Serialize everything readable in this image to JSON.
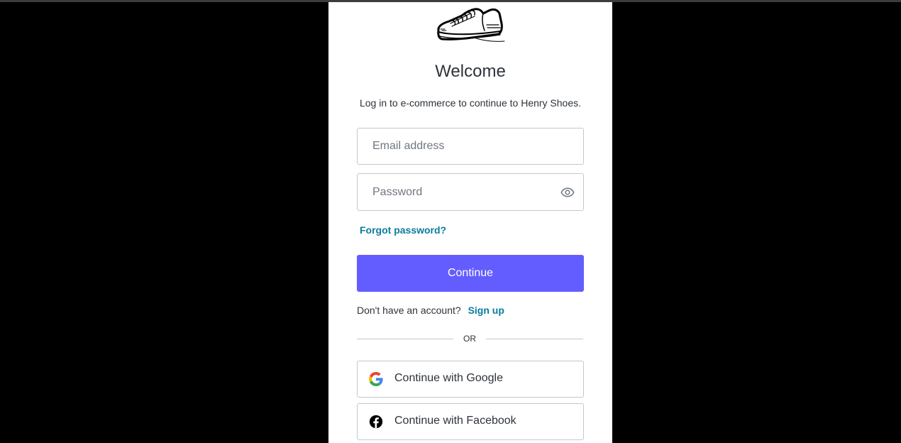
{
  "page": {
    "title": "Welcome",
    "subtitle": "Log in to e-commerce to continue to Henry Shoes.",
    "logo_icon": "shoe-icon"
  },
  "form": {
    "email_placeholder": "Email address",
    "email_value": "",
    "password_placeholder": "Password",
    "password_value": "",
    "password_toggle_icon": "eye-icon",
    "forgot_label": "Forgot password?",
    "continue_label": "Continue"
  },
  "signup": {
    "prompt": "Don't have an account?",
    "link_label": "Sign up"
  },
  "divider": {
    "label": "OR"
  },
  "social": [
    {
      "label": "Continue with Google",
      "icon": "google-icon"
    },
    {
      "label": "Continue with Facebook",
      "icon": "facebook-icon"
    }
  ],
  "colors": {
    "background": "#000000",
    "card": "#ffffff",
    "primary_button": "#635dff",
    "link": "#0a7c9e",
    "text": "#2d333a",
    "border": "#c2c8d0"
  }
}
